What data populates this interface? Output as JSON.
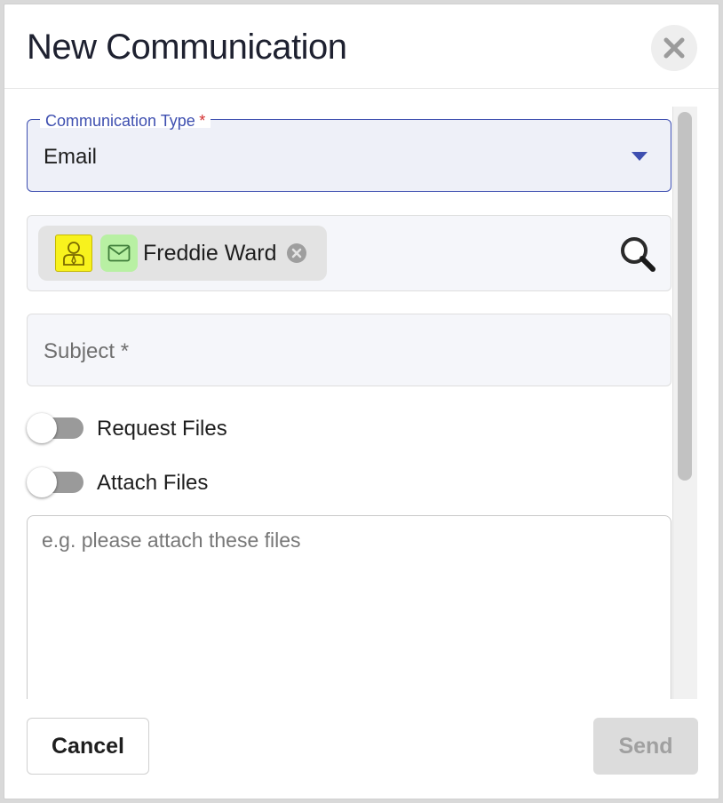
{
  "dialog": {
    "title": "New Communication",
    "close_icon": "close-icon"
  },
  "communication_type": {
    "label": "Communication Type",
    "required_marker": "*",
    "value": "Email",
    "dropdown_icon": "caret-down-icon"
  },
  "recipients": {
    "chips": [
      {
        "name": "Freddie Ward",
        "contact_icon": "contact-person-icon",
        "channel_icon": "envelope-icon",
        "remove_icon": "remove-chip-icon"
      }
    ],
    "search_icon": "search-icon"
  },
  "subject": {
    "placeholder": "Subject *"
  },
  "toggles": [
    {
      "label": "Request Files",
      "on": false
    },
    {
      "label": "Attach Files",
      "on": false
    }
  ],
  "message": {
    "placeholder": "e.g. please attach these files"
  },
  "footer": {
    "cancel_label": "Cancel",
    "send_label": "Send"
  },
  "colors": {
    "accent": "#3e4fb0",
    "required": "#d32f2f",
    "contact_icon_bg": "#f8f21d",
    "email_icon_bg": "#b8f0a3",
    "send_disabled_bg": "#dcdcdc"
  }
}
